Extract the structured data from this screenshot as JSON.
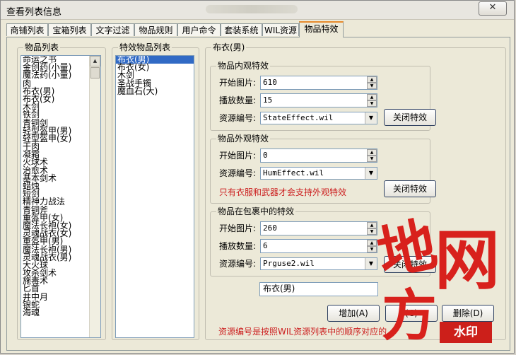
{
  "window": {
    "title": "查看列表信息",
    "close_label": "✕"
  },
  "tabs": [
    {
      "label": "商铺列表"
    },
    {
      "label": "宝箱列表"
    },
    {
      "label": "文字过滤"
    },
    {
      "label": "物品规则"
    },
    {
      "label": "用户命令"
    },
    {
      "label": "套装系统"
    },
    {
      "label": "WIL资源"
    },
    {
      "label": "物品特效"
    }
  ],
  "item_list": {
    "label": "物品列表",
    "items": [
      "命运之书",
      "金创药(小量)",
      "魔法药(小量)",
      "肉",
      "布衣(男)",
      "布衣(女)",
      "木剑",
      "铁剑",
      "青铜剑",
      "轻型盔甲(男)",
      "轻型盔甲(女)",
      "干肉",
      "凝霜",
      "火球术",
      "治愈术",
      "基本剑术",
      "蜡烛",
      "短剑",
      "精神力战法",
      "青铜斧",
      "重盔甲(女)",
      "魔法长袍(女)",
      "灵魂战衣(女)",
      "重盔甲(男)",
      "魔法长袍(男)",
      "灵魂战衣(男)",
      "大火球",
      "攻杀剑术",
      "施毒术",
      "匕首",
      "井中月",
      "银蛇",
      "海魂"
    ]
  },
  "effect_list": {
    "label": "特效物品列表",
    "items": [
      "布衣(男)",
      "布衣(女)",
      "木剑",
      "圣战手镯",
      "魔血石(大)"
    ],
    "selected": 0
  },
  "details": {
    "label": "布衣(男)",
    "inner": {
      "label": "物品内观特效",
      "start_label": "开始图片:",
      "start_value": "610",
      "count_label": "播放数量:",
      "count_value": "15",
      "res_label": "资源编号:",
      "res_value": "StateEffect.wil",
      "close_btn": "关闭特效"
    },
    "outer": {
      "label": "物品外观特效",
      "start_label": "开始图片:",
      "start_value": "0",
      "res_label": "资源编号:",
      "res_value": "HumEffect.wil",
      "note": "只有衣服和武器才会支持外观特效",
      "close_btn": "关闭特效"
    },
    "bag": {
      "label": "物品在包裹中的特效",
      "start_label": "开始图片:",
      "start_value": "260",
      "count_label": "播放数量:",
      "count_value": "6",
      "res_label": "资源编号:",
      "res_value": "Prguse2.wil",
      "close_btn": "关闭特效"
    },
    "name_value": "布衣(男)",
    "add_btn": "增加(A)",
    "modify_btn": "(C)",
    "delete_btn": "删除(D)",
    "footer_note": "资源编号是按照WIL资源列表中的顺序对应的..."
  },
  "watermark": {
    "chars": [
      "地",
      "网",
      "方"
    ],
    "badge": "水印"
  }
}
